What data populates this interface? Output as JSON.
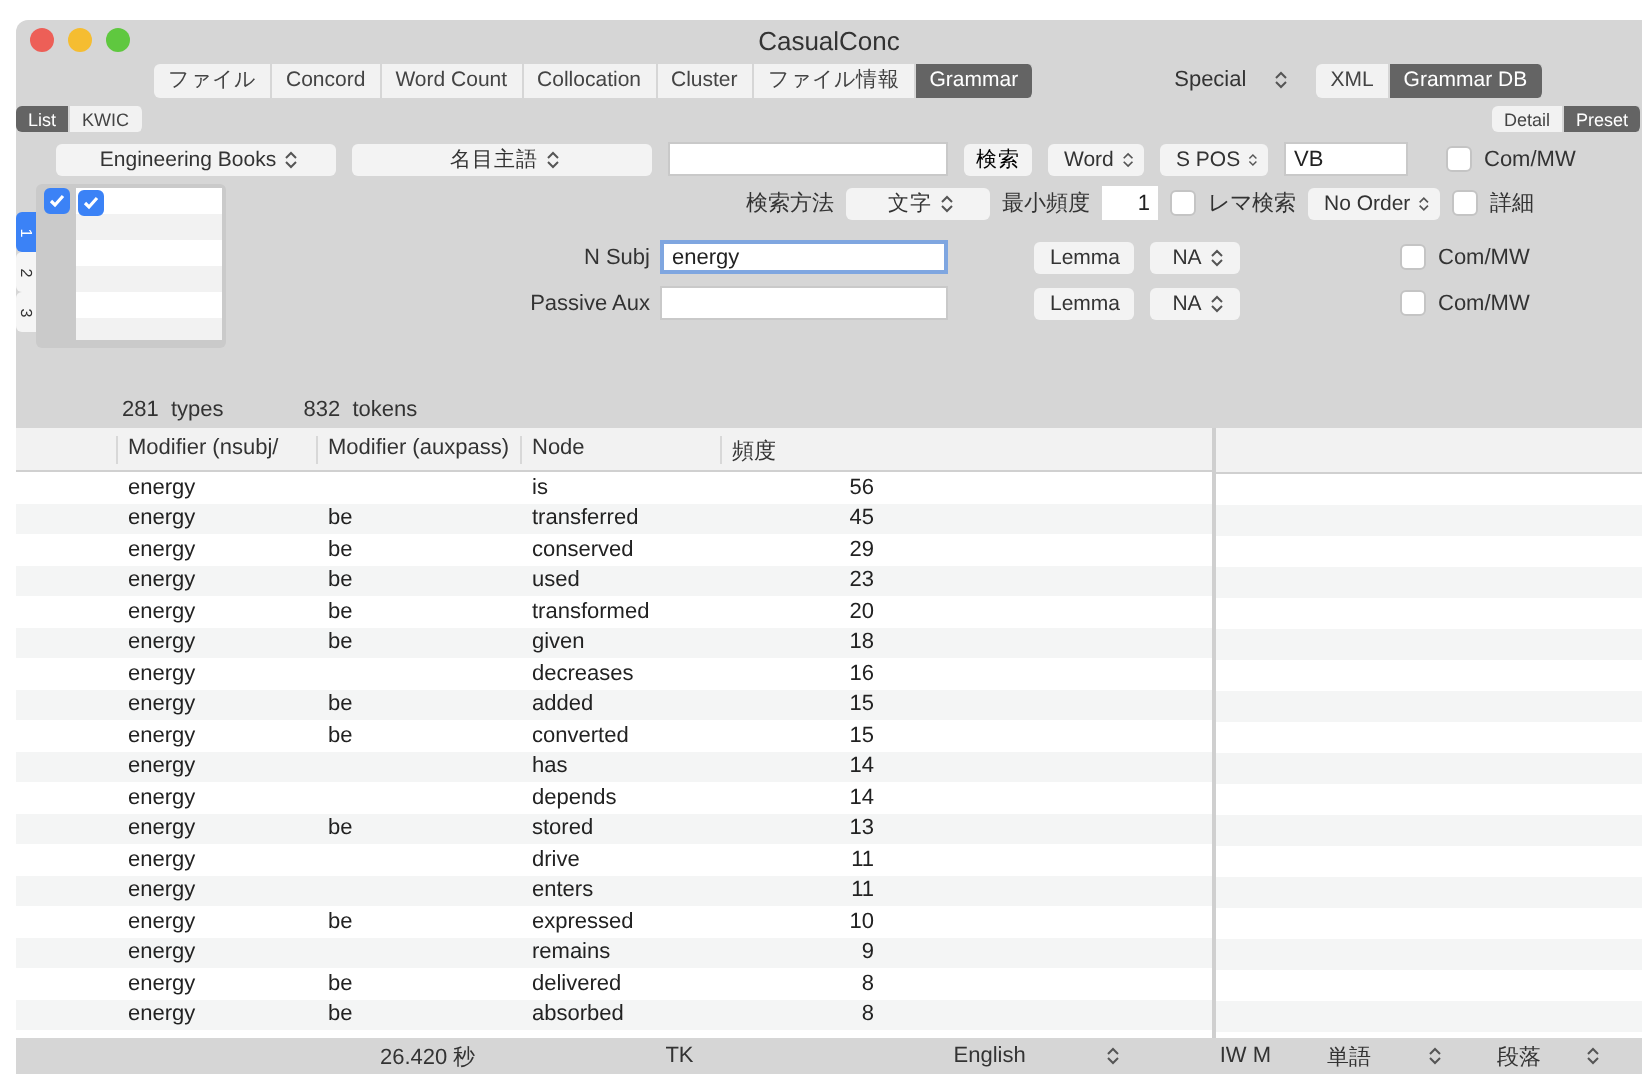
{
  "window": {
    "title": "CasualConc"
  },
  "toolbar": {
    "tabs": [
      {
        "label": "ファイル",
        "selected": false
      },
      {
        "label": "Concord",
        "selected": false
      },
      {
        "label": "Word Count",
        "selected": false
      },
      {
        "label": "Collocation",
        "selected": false
      },
      {
        "label": "Cluster",
        "selected": false
      },
      {
        "label": "ファイル情報",
        "selected": false
      },
      {
        "label": "Grammar",
        "selected": true
      }
    ],
    "special_select": "Special",
    "mode_tabs": [
      {
        "label": "XML",
        "selected": false
      },
      {
        "label": "Grammar DB",
        "selected": true
      }
    ]
  },
  "view_tabs": [
    {
      "label": "List",
      "selected": true
    },
    {
      "label": "KWIC",
      "selected": false
    }
  ],
  "detail_tabs": [
    {
      "label": "Detail",
      "selected": false
    },
    {
      "label": "Preset",
      "selected": true
    }
  ],
  "query": {
    "corpus_select": "Engineering Books",
    "relation_select": "名目主語",
    "search_button": "検索",
    "word_select": "Word",
    "pos_select": "S POS",
    "pos_value": "VB",
    "com_mw": {
      "label": "Com/MW",
      "checked": false
    },
    "method_label": "検索方法",
    "method_select": "文字",
    "min_freq_label": "最小頻度",
    "min_freq": "1",
    "lemma_search": {
      "label": "レマ検索",
      "checked": false
    },
    "order_select": "No Order",
    "detail_check": {
      "label": "詳細",
      "checked": false
    }
  },
  "slot_tabs": [
    {
      "label": "1",
      "selected": true
    },
    {
      "label": "2",
      "selected": false
    },
    {
      "label": "3",
      "selected": false
    }
  ],
  "slot_checks": [
    {
      "checked": true
    },
    {
      "checked": true
    }
  ],
  "slots": [
    {
      "label": "N Subj",
      "value": "energy",
      "focused": true,
      "form_select": "Lemma",
      "pos_select": "NA",
      "com_mw": {
        "label": "Com/MW",
        "checked": false
      }
    },
    {
      "label": "Passive Aux",
      "focused": false,
      "form_select": "Lemma",
      "pos_select": "NA",
      "com_mw": {
        "label": "Com/MW",
        "checked": false
      }
    }
  ],
  "stats": {
    "types": "281  types",
    "tokens": "832  tokens"
  },
  "table": {
    "columns": [
      "Modifier (nsubj/",
      "Modifier (auxpass)",
      "Node",
      "頻度"
    ],
    "rows": [
      [
        "energy",
        "",
        "is",
        "56"
      ],
      [
        "energy",
        "be",
        "transferred",
        "45"
      ],
      [
        "energy",
        "be",
        "conserved",
        "29"
      ],
      [
        "energy",
        "be",
        "used",
        "23"
      ],
      [
        "energy",
        "be",
        "transformed",
        "20"
      ],
      [
        "energy",
        "be",
        "given",
        "18"
      ],
      [
        "energy",
        "",
        "decreases",
        "16"
      ],
      [
        "energy",
        "be",
        "added",
        "15"
      ],
      [
        "energy",
        "be",
        "converted",
        "15"
      ],
      [
        "energy",
        "",
        "has",
        "14"
      ],
      [
        "energy",
        "",
        "depends",
        "14"
      ],
      [
        "energy",
        "be",
        "stored",
        "13"
      ],
      [
        "energy",
        "",
        "drive",
        "11"
      ],
      [
        "energy",
        "",
        "enters",
        "11"
      ],
      [
        "energy",
        "be",
        "expressed",
        "10"
      ],
      [
        "energy",
        "",
        "remains",
        "9"
      ],
      [
        "energy",
        "be",
        "delivered",
        "8"
      ],
      [
        "energy",
        "be",
        "absorbed",
        "8"
      ]
    ]
  },
  "status_bar": {
    "time": "26.420 秒",
    "tk": "TK",
    "language_select": "English",
    "iwm": "IW M",
    "unit_select": "単語",
    "para_select": "段落"
  }
}
